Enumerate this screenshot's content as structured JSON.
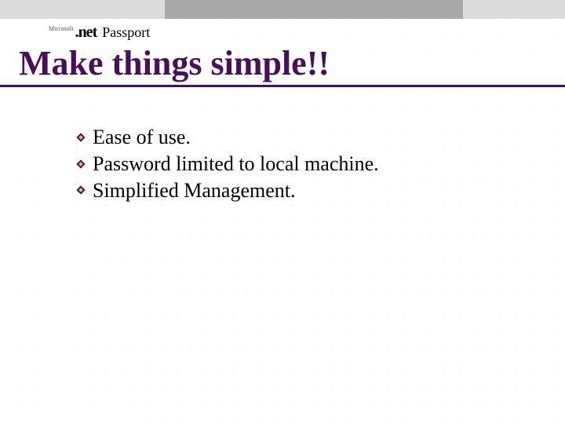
{
  "logo": {
    "microsoft": "Microsoft",
    "dotnet": ".net",
    "passport": "Passport"
  },
  "title": "Make things simple!!",
  "bullets": [
    "Ease of use.",
    "Password limited to local machine.",
    "Simplified Management."
  ],
  "colors": {
    "title": "#4a0f5c",
    "bullet_fill": "#4a0f5c",
    "top_bar_light": "#dcdcdc",
    "top_bar_dark": "#a9a9a9"
  }
}
